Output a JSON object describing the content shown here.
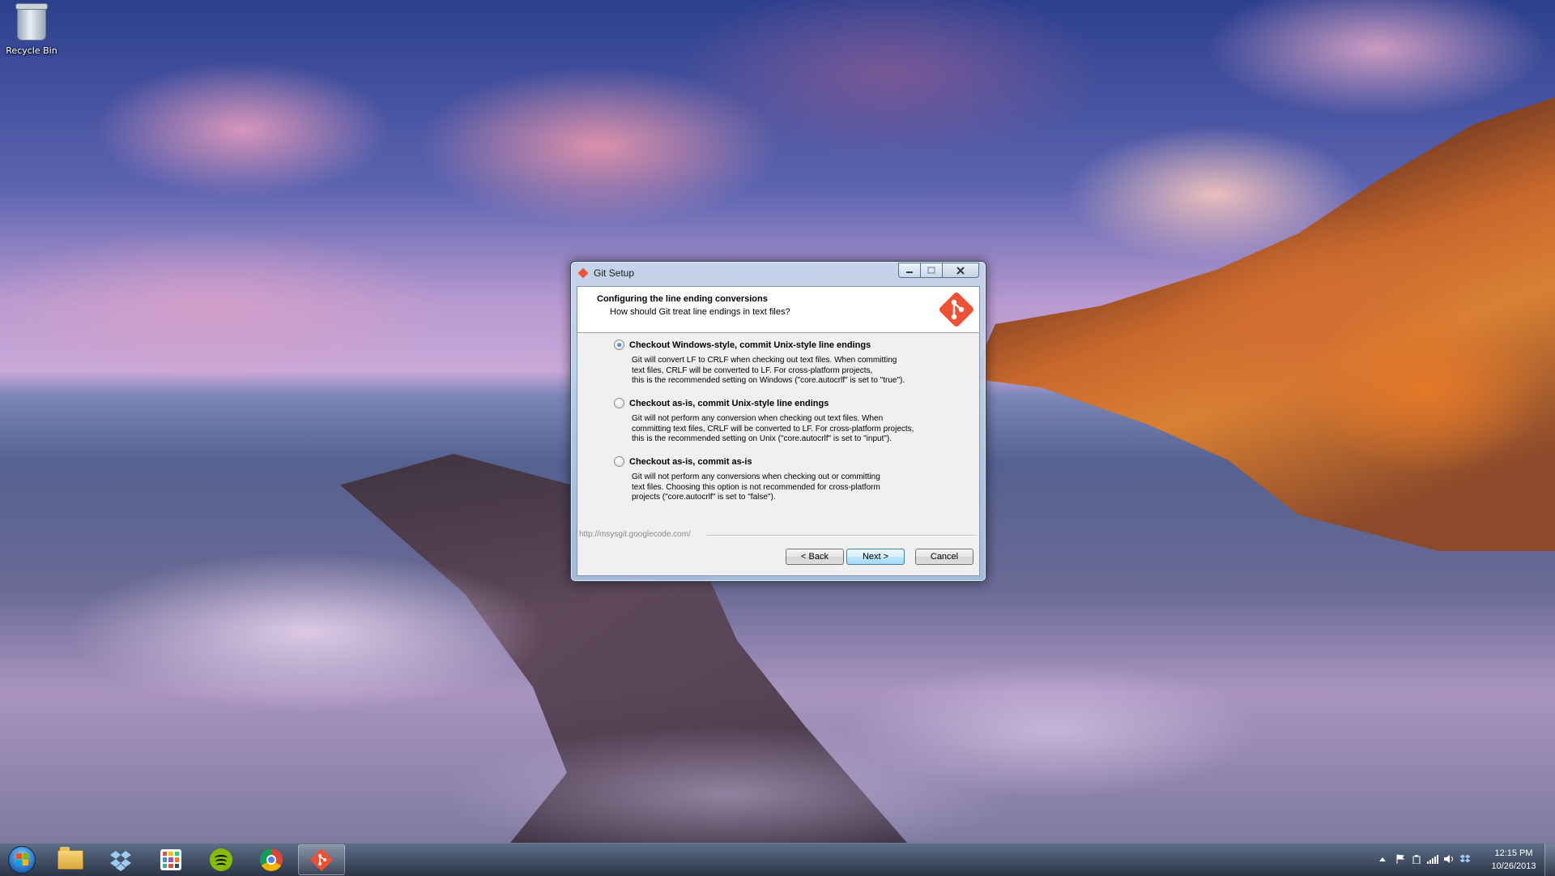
{
  "desktop": {
    "icons": [
      {
        "label": "Recycle Bin",
        "icon": "recycle-bin-icon"
      }
    ]
  },
  "window": {
    "title": "Git Setup",
    "title_icon": "git-logo-icon",
    "controls": {
      "minimize": "minimize",
      "maximize": "maximize",
      "close": "close"
    },
    "header": {
      "title": "Configuring the line ending conversions",
      "subtitle": "How should Git treat line endings in text files?",
      "logo": "git-logo-icon",
      "logo_color": "#f05133"
    },
    "options": [
      {
        "label": "Checkout Windows-style, commit Unix-style line endings",
        "selected": true,
        "description": [
          "Git will convert LF to CRLF when checking out text files. When committing",
          "text files, CRLF will be converted to LF. For cross-platform projects,",
          "this is the recommended setting on Windows (\"core.autocrlf\" is set to \"true\")."
        ]
      },
      {
        "label": "Checkout as-is, commit Unix-style line endings",
        "selected": false,
        "description": [
          "Git will not perform any conversion when checking out text files. When",
          "committing text files, CRLF will be converted to LF. For cross-platform projects,",
          "this is the recommended setting on Unix (\"core.autocrlf\" is set to \"input\")."
        ]
      },
      {
        "label": "Checkout as-is, commit as-is",
        "selected": false,
        "description": [
          "Git will not perform any conversions when checking out or committing",
          "text files. Choosing this option is not recommended for cross-platform",
          "projects (\"core.autocrlf\" is set to \"false\")."
        ]
      }
    ],
    "footer_url": "http://msysgit.googlecode.com/",
    "buttons": {
      "back": "< Back",
      "next": "Next >",
      "cancel": "Cancel"
    }
  },
  "taskbar": {
    "start_icon": "windows-start-orb-icon",
    "pinned": [
      {
        "name": "windows-explorer",
        "icon": "folder-icon"
      },
      {
        "name": "dropbox",
        "icon": "dropbox-icon"
      },
      {
        "name": "app-grid",
        "icon": "app-grid-icon"
      },
      {
        "name": "spotify",
        "icon": "spotify-icon"
      },
      {
        "name": "chrome",
        "icon": "chrome-icon"
      },
      {
        "name": "git-setup",
        "icon": "git-logo-icon",
        "active": true
      }
    ],
    "tray": {
      "icons": [
        "show-hidden-icons-icon",
        "action-center-flag-icon",
        "power-icon",
        "network-signal-icon",
        "volume-icon",
        "dropbox-tray-icon"
      ],
      "time": "12:15 PM",
      "date": "10/26/2013"
    }
  },
  "colors": {
    "git_orange": "#f05133",
    "spotify_green": "#84bd00",
    "primary_button_border": "#3c7fb1"
  }
}
